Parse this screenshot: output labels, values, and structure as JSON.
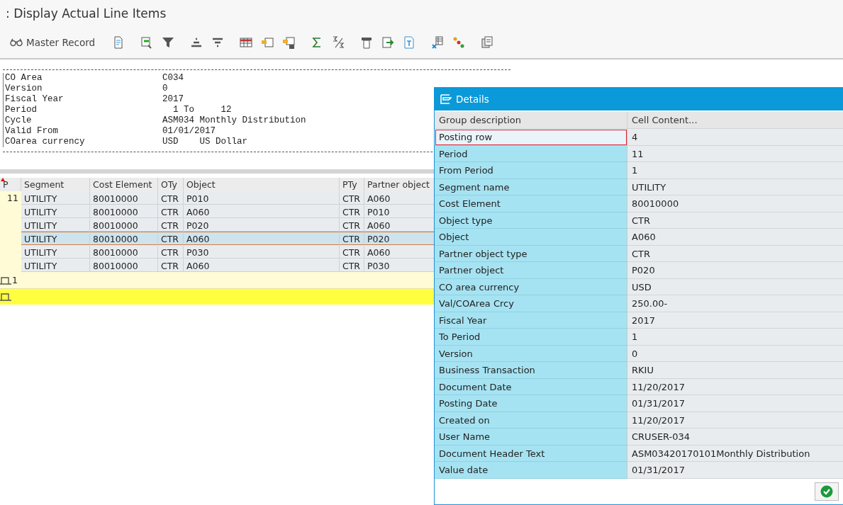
{
  "title": ": Display Actual Line Items",
  "toolbar": {
    "master_record": "Master Record"
  },
  "report_header": [
    {
      "label": "CO Area",
      "value": "C034"
    },
    {
      "label": "Version",
      "value": "0"
    },
    {
      "label": "Fiscal Year",
      "value": "2017"
    },
    {
      "label": "Period",
      "value": "  1 To     12"
    },
    {
      "label": "Cycle",
      "value": "ASM034 Monthly Distribution"
    },
    {
      "label": "Valid From",
      "value": "01/01/2017"
    },
    {
      "label": "COarea currency",
      "value": "USD    US Dollar"
    }
  ],
  "grid": {
    "columns": [
      "P",
      "Segment",
      "Cost Element",
      "OTy",
      "Object",
      "PTy",
      "Partner object"
    ],
    "rows": [
      {
        "cells": [
          "11",
          "UTILITY",
          "80010000",
          "CTR",
          "P010",
          "CTR",
          "A060"
        ],
        "selected": false
      },
      {
        "cells": [
          "",
          "UTILITY",
          "80010000",
          "CTR",
          "A060",
          "CTR",
          "P010"
        ],
        "selected": false
      },
      {
        "cells": [
          "",
          "UTILITY",
          "80010000",
          "CTR",
          "P020",
          "CTR",
          "A060"
        ],
        "selected": false
      },
      {
        "cells": [
          "",
          "UTILITY",
          "80010000",
          "CTR",
          "A060",
          "CTR",
          "P020"
        ],
        "selected": true
      },
      {
        "cells": [
          "",
          "UTILITY",
          "80010000",
          "CTR",
          "P030",
          "CTR",
          "A060"
        ],
        "selected": false
      },
      {
        "cells": [
          "",
          "UTILITY",
          "80010000",
          "CTR",
          "A060",
          "CTR",
          "P030"
        ],
        "selected": false
      }
    ],
    "subtotal": "1"
  },
  "details": {
    "title": "Details",
    "columns": [
      "Group description",
      "Cell Content..."
    ],
    "rows": [
      {
        "label": "Posting row",
        "value": "4",
        "focused": true
      },
      {
        "label": "Period",
        "value": "11",
        "focused": false
      },
      {
        "label": "From Period",
        "value": "1",
        "focused": false
      },
      {
        "label": "Segment name",
        "value": "UTILITY",
        "focused": false
      },
      {
        "label": "Cost Element",
        "value": "80010000",
        "focused": false
      },
      {
        "label": "Object type",
        "value": "CTR",
        "focused": false
      },
      {
        "label": "Object",
        "value": "A060",
        "focused": false
      },
      {
        "label": "Partner object type",
        "value": "CTR",
        "focused": false
      },
      {
        "label": "Partner object",
        "value": "P020",
        "focused": false
      },
      {
        "label": "CO area currency",
        "value": "USD",
        "focused": false
      },
      {
        "label": "Val/COArea Crcy",
        "value": "250.00-",
        "focused": false
      },
      {
        "label": "Fiscal Year",
        "value": "2017",
        "focused": false
      },
      {
        "label": "To Period",
        "value": "1",
        "focused": false
      },
      {
        "label": "Version",
        "value": "0",
        "focused": false
      },
      {
        "label": "Business Transaction",
        "value": "RKIU",
        "focused": false
      },
      {
        "label": "Document Date",
        "value": "11/20/2017",
        "focused": false
      },
      {
        "label": "Posting Date",
        "value": "01/31/2017",
        "focused": false
      },
      {
        "label": "Created on",
        "value": "11/20/2017",
        "focused": false
      },
      {
        "label": "User Name",
        "value": "CRUSER-034",
        "focused": false
      },
      {
        "label": "Document Header Text",
        "value": "ASM03420170101Monthly Distribution",
        "focused": false
      },
      {
        "label": "Value date",
        "value": "01/31/2017",
        "focused": false
      }
    ]
  }
}
